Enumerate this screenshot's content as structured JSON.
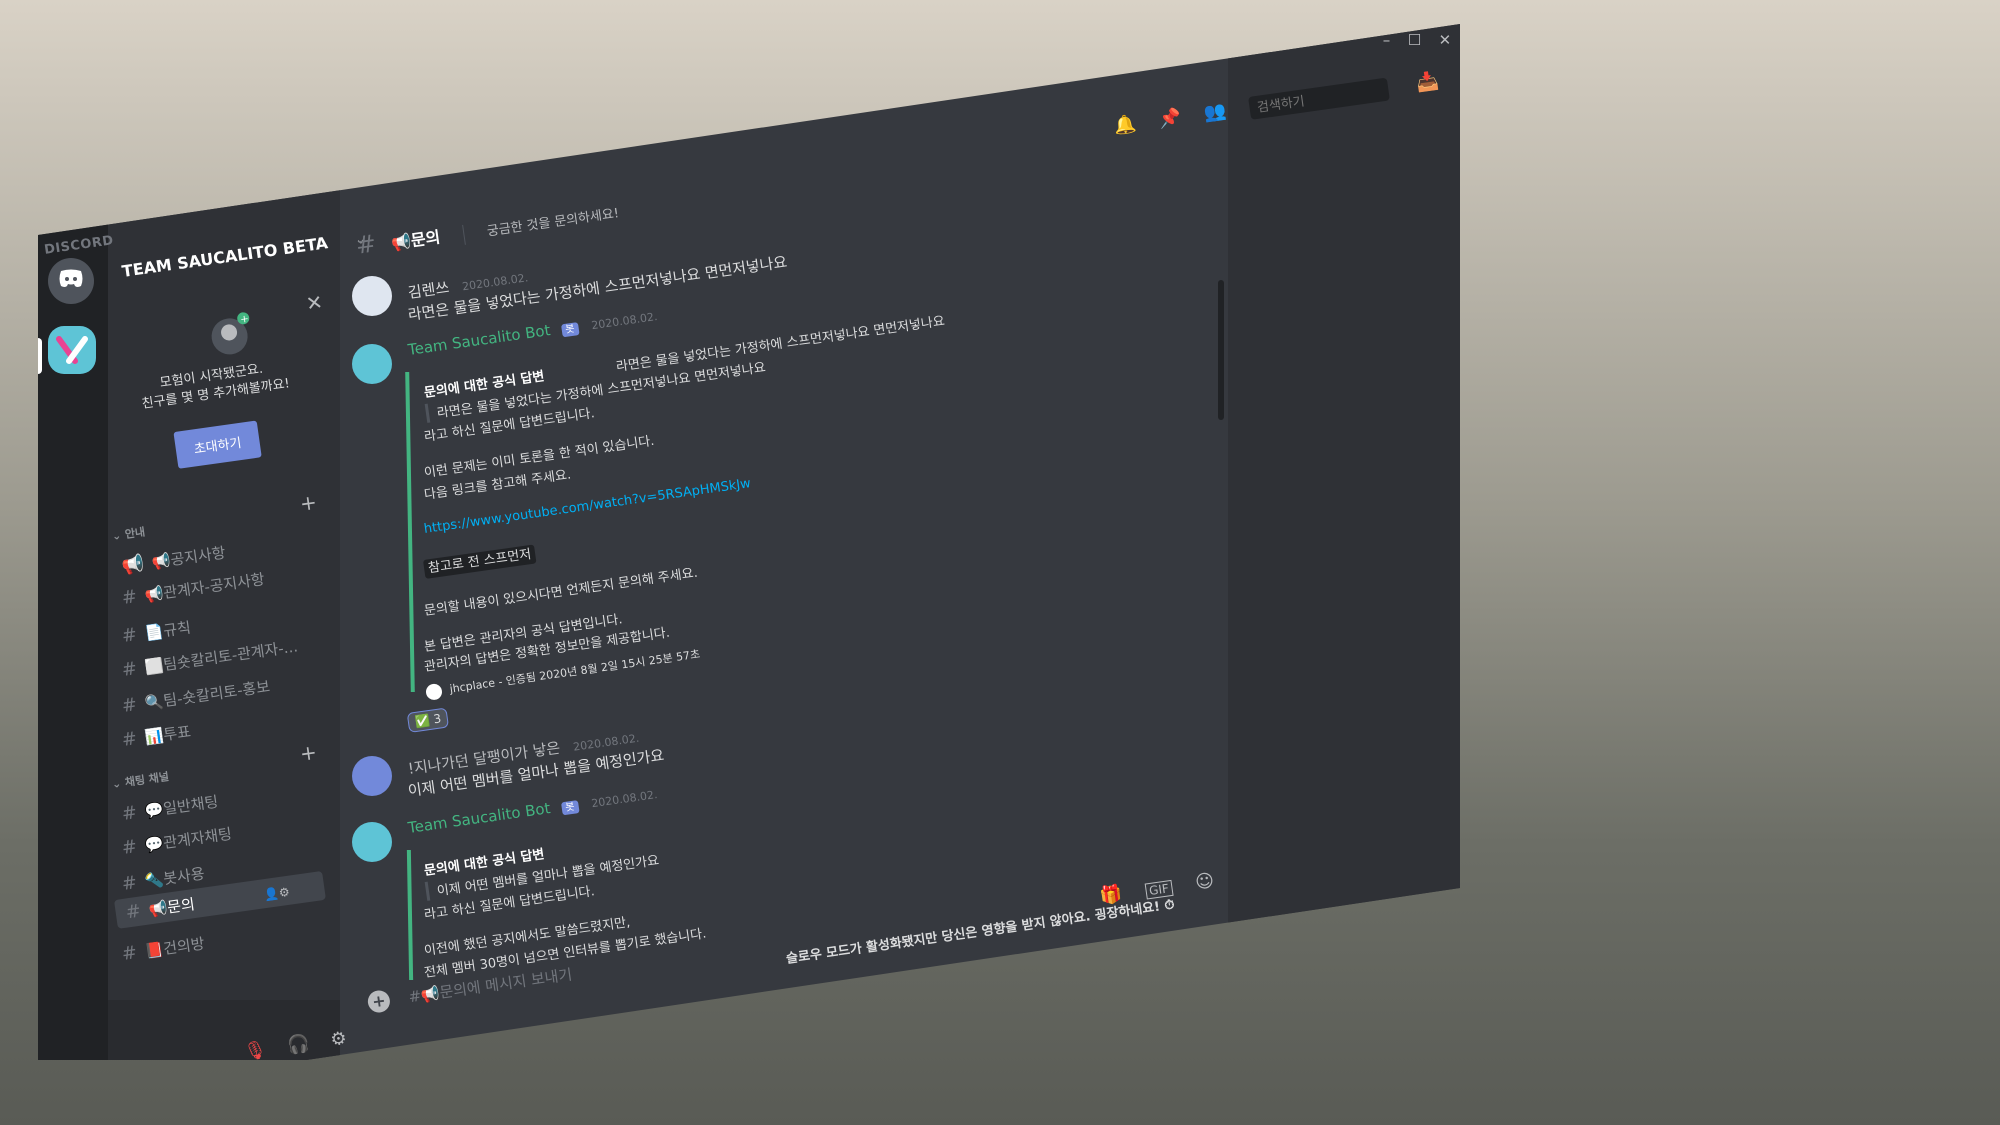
{
  "window": {
    "brand": "DISCORD",
    "controls": [
      "–",
      "☐",
      "✕"
    ]
  },
  "server": {
    "name": "TEAM SAUCALITO BETA"
  },
  "invite": {
    "line1": "모험이 시작됐군요.",
    "line2": "친구를 몇 명 추가해볼까요!",
    "button": "초대하기"
  },
  "categories": [
    {
      "name": "안내",
      "channels": [
        {
          "icon": "📢",
          "label": "📢공지사항"
        },
        {
          "icon": "#",
          "label": "📢관계자-공지사항"
        },
        {
          "icon": "#",
          "label": "📄규칙"
        },
        {
          "icon": "#",
          "label": "⬜팀숏칼리토-관계자-..."
        },
        {
          "icon": "#",
          "label": "🔍팀-숏칼리토-홍보"
        },
        {
          "icon": "#",
          "label": "📊투표"
        }
      ]
    },
    {
      "name": "채팅 채널",
      "channels": [
        {
          "icon": "#",
          "label": "💬일반채팅"
        },
        {
          "icon": "#",
          "label": "💬관계자채팅"
        },
        {
          "icon": "#",
          "label": "🔦봇사용"
        },
        {
          "icon": "#",
          "label": "📢문의"
        },
        {
          "icon": "#",
          "label": "📕건의방"
        }
      ]
    }
  ],
  "header": {
    "channel": "📢문의",
    "topic": "궁금한 것을 문의하세요!",
    "search_placeholder": "검색하기"
  },
  "messages": {
    "m1": {
      "author": "김렌쓰",
      "time": "2020.08.02.",
      "text": "라면은 물을 넣었다는 가정하에 스프먼저넣나요 면먼저넣나요"
    },
    "m2": {
      "author": "Team Saucalito Bot",
      "tag": "봇",
      "time": "2020.08.02.",
      "embed": {
        "top": "라면은 물을 넣었다는 가정하에 스프먼저넣나요 면먼저넣나요",
        "title": "문의에 대한 공식 답변",
        "quote": "라면은 물을 넣었다는 가정하에 스프먼저넣나요 면먼저넣나요",
        "said": "라고 하신 질문에 답변드립니다.",
        "p1": "이런 문제는 이미 토론을 한 적이 있습니다.",
        "p2": "다음 링크를 참고해 주세요.",
        "link": "https://www.youtube.com/watch?v=5RSApHMSkJw",
        "code": "참고로 전 스프먼저",
        "p3": "문의할 내용이 있으시다면 언제든지 문의해 주세요.",
        "p4": "본 답변은 관리자의 공식 답변입니다.",
        "p5": "관리자의 답변은 정확한 정보만을 제공합니다.",
        "footer": "jhcplace - 인증됨 2020년 8월 2일 15시 25분 57초"
      },
      "reaction": "3"
    },
    "m3": {
      "author": "!지나가던 달팽이가 낳은",
      "time": "2020.08.02.",
      "text": "이제 어떤 멤버를 얼마나 뽑을 예정인가요"
    },
    "m4": {
      "author": "Team Saucalito Bot",
      "tag": "봇",
      "time": "2020.08.02.",
      "embed": {
        "title": "문의에 대한 공식 답변",
        "quote": "이제 어떤 멤버를 얼마나 뽑을 예정인가요",
        "said": "라고 하신 질문에 답변드립니다.",
        "p1": "이전에 했던 공지에서도 말씀드렸지만,",
        "p2": "전체 멤버 30명이 넘으면 인터뷰를 뽑기로 했습니다."
      }
    }
  },
  "composer": {
    "placeholder": "#📢문의에 메시지 보내기",
    "slowmode": "슬로우 모드가 활성화됐지만 당신은 영향을 받지 않아요. 굉장하네요! ⏱"
  },
  "colors": {
    "accent": "#7289da",
    "online": "#43b581",
    "bot_name": "#43b581",
    "link": "#00b0f4"
  }
}
